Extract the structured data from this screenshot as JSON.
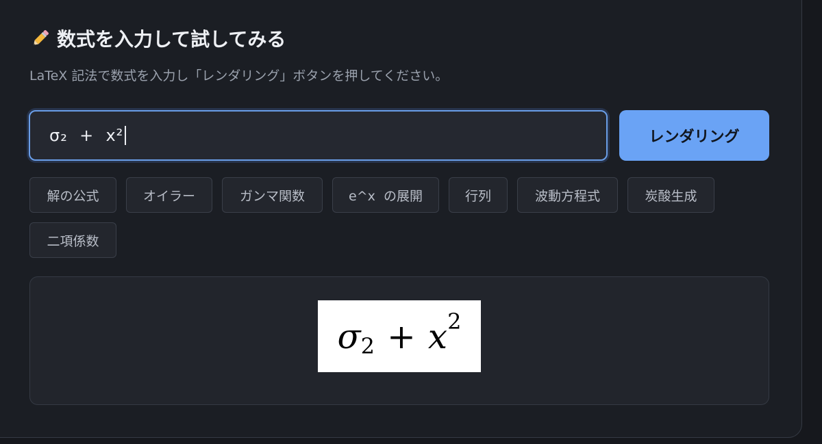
{
  "header": {
    "icon": "pencil-icon",
    "title": "数式を入力して試してみる",
    "subtitle": "LaTeX 記法で数式を入力し「レンダリング」ボタンを押してください。"
  },
  "input": {
    "value": "σ₂  +  x²"
  },
  "render_button": {
    "label": "レンダリング"
  },
  "examples": [
    "解の公式",
    "オイラー",
    "ガンマ関数",
    "e^x  の展開",
    "行列",
    "波動方程式",
    "炭酸生成",
    "二項係数"
  ],
  "preview": {
    "base": "σ",
    "base_sub": "2",
    "operator": "+",
    "term": "x",
    "term_sup": "2"
  },
  "colors": {
    "accent": "#6aa3f5",
    "background": "#1b1e24"
  }
}
